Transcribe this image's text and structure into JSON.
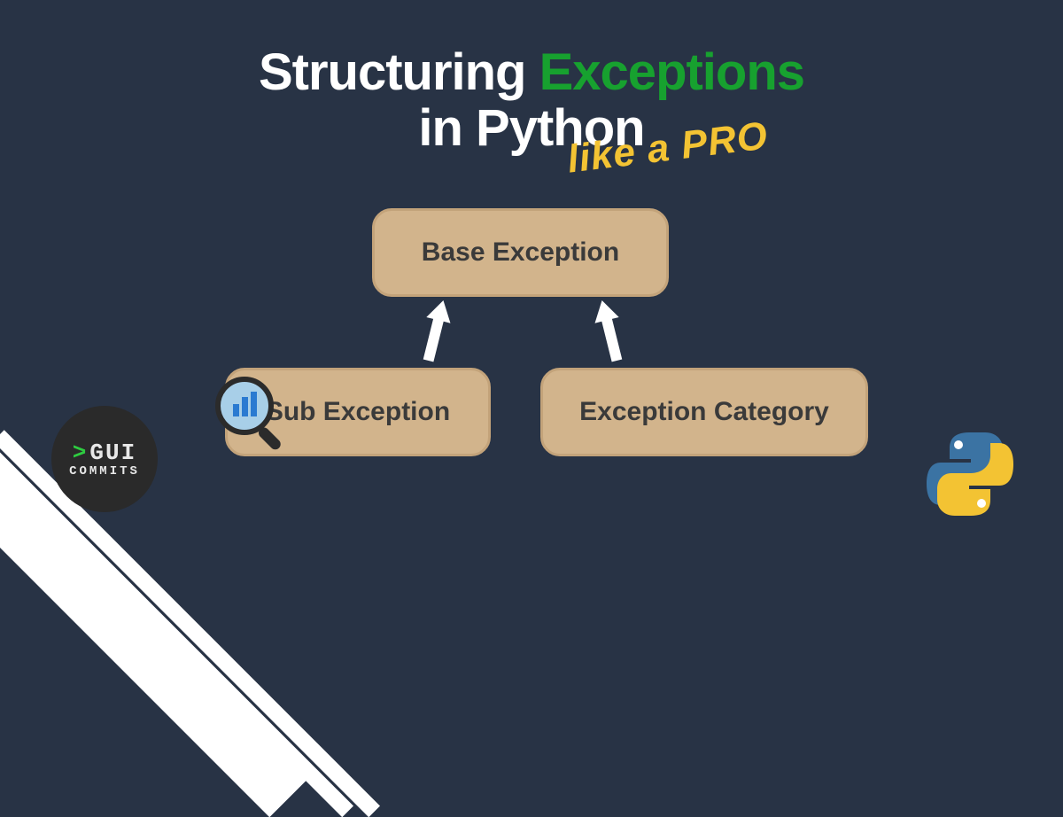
{
  "title": {
    "line1_a": "Structuring ",
    "line1_b": "Exceptions",
    "line2": "in Python",
    "tagline": "like a PRO"
  },
  "diagram": {
    "base": "Base Exception",
    "sub": "Sub Exception",
    "category": "Exception Category"
  },
  "logo": {
    "prompt": ">",
    "name": "GUI",
    "sub": "COMMITS"
  },
  "colors": {
    "background": "#283345",
    "box": "#d2b48c",
    "green": "#17a12f",
    "yellow": "#f3c333"
  }
}
